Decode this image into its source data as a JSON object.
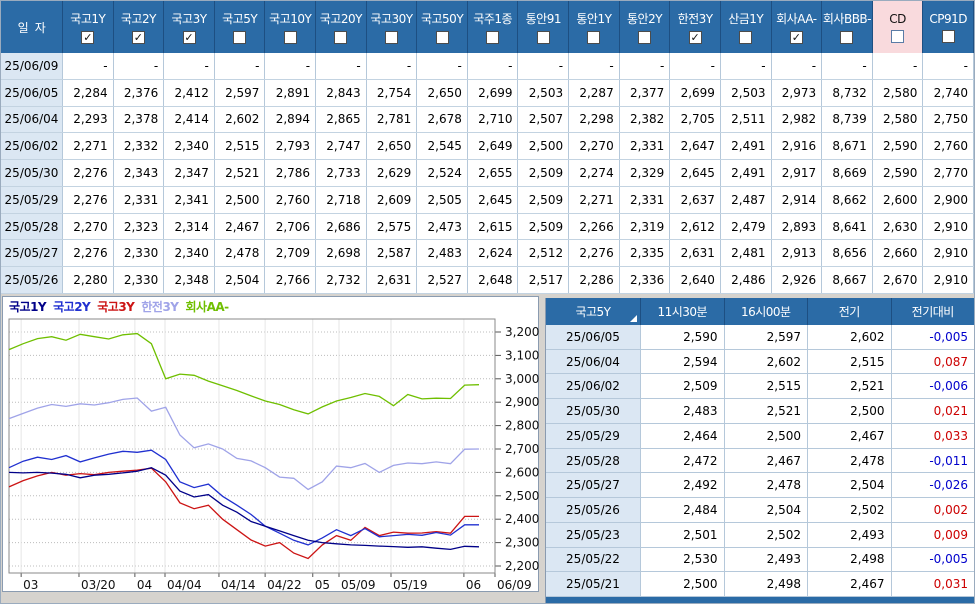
{
  "window": {
    "accent_blue": "#2b6ba6",
    "header_highlight_pink": "#f9dadd",
    "date_cell_blue": "#dbe7f3"
  },
  "colors": {
    "negative": "#0000cc",
    "positive": "#cc0000"
  },
  "top_table": {
    "date_header": "일  자",
    "columns": [
      {
        "label": "국고1Y",
        "checked": true,
        "highlight": false
      },
      {
        "label": "국고2Y",
        "checked": true,
        "highlight": false
      },
      {
        "label": "국고3Y",
        "checked": true,
        "highlight": false
      },
      {
        "label": "국고5Y",
        "checked": false,
        "highlight": false
      },
      {
        "label": "국고10Y",
        "checked": false,
        "highlight": false
      },
      {
        "label": "국고20Y",
        "checked": false,
        "highlight": false
      },
      {
        "label": "국고30Y",
        "checked": false,
        "highlight": false
      },
      {
        "label": "국고50Y",
        "checked": false,
        "highlight": false
      },
      {
        "label": "국주1종",
        "checked": false,
        "highlight": false
      },
      {
        "label": "통안91",
        "checked": false,
        "highlight": false
      },
      {
        "label": "통안1Y",
        "checked": false,
        "highlight": false
      },
      {
        "label": "통안2Y",
        "checked": false,
        "highlight": false
      },
      {
        "label": "한전3Y",
        "checked": true,
        "highlight": false
      },
      {
        "label": "산금1Y",
        "checked": false,
        "highlight": false
      },
      {
        "label": "회사AA-",
        "checked": true,
        "highlight": false
      },
      {
        "label": "회사BBB-",
        "checked": false,
        "highlight": false
      },
      {
        "label": "CD",
        "checked": false,
        "highlight": true
      },
      {
        "label": "CP91D",
        "checked": false,
        "highlight": false
      }
    ],
    "rows": [
      {
        "date": "25/06/09",
        "values": [
          "-",
          "-",
          "-",
          "-",
          "-",
          "-",
          "-",
          "-",
          "-",
          "-",
          "-",
          "-",
          "-",
          "-",
          "-",
          "-",
          "-",
          "-"
        ]
      },
      {
        "date": "25/06/05",
        "values": [
          "2,284",
          "2,376",
          "2,412",
          "2,597",
          "2,891",
          "2,843",
          "2,754",
          "2,650",
          "2,699",
          "2,503",
          "2,287",
          "2,377",
          "2,699",
          "2,503",
          "2,973",
          "8,732",
          "2,580",
          "2,740"
        ]
      },
      {
        "date": "25/06/04",
        "values": [
          "2,293",
          "2,378",
          "2,414",
          "2,602",
          "2,894",
          "2,865",
          "2,781",
          "2,678",
          "2,710",
          "2,507",
          "2,298",
          "2,382",
          "2,705",
          "2,511",
          "2,982",
          "8,739",
          "2,580",
          "2,750"
        ]
      },
      {
        "date": "25/06/02",
        "values": [
          "2,271",
          "2,332",
          "2,340",
          "2,515",
          "2,793",
          "2,747",
          "2,650",
          "2,545",
          "2,649",
          "2,500",
          "2,270",
          "2,331",
          "2,647",
          "2,491",
          "2,916",
          "8,671",
          "2,590",
          "2,760"
        ]
      },
      {
        "date": "25/05/30",
        "values": [
          "2,276",
          "2,343",
          "2,347",
          "2,521",
          "2,786",
          "2,733",
          "2,629",
          "2,524",
          "2,655",
          "2,509",
          "2,274",
          "2,329",
          "2,645",
          "2,491",
          "2,917",
          "8,669",
          "2,590",
          "2,770"
        ]
      },
      {
        "date": "25/05/29",
        "values": [
          "2,276",
          "2,331",
          "2,341",
          "2,500",
          "2,760",
          "2,718",
          "2,609",
          "2,505",
          "2,645",
          "2,509",
          "2,271",
          "2,331",
          "2,637",
          "2,487",
          "2,914",
          "8,662",
          "2,600",
          "2,900"
        ]
      },
      {
        "date": "25/05/28",
        "values": [
          "2,270",
          "2,323",
          "2,314",
          "2,467",
          "2,706",
          "2,686",
          "2,575",
          "2,473",
          "2,615",
          "2,509",
          "2,266",
          "2,319",
          "2,612",
          "2,479",
          "2,893",
          "8,641",
          "2,630",
          "2,910"
        ]
      },
      {
        "date": "25/05/27",
        "values": [
          "2,276",
          "2,330",
          "2,340",
          "2,478",
          "2,709",
          "2,698",
          "2,587",
          "2,483",
          "2,624",
          "2,512",
          "2,276",
          "2,335",
          "2,631",
          "2,481",
          "2,913",
          "8,656",
          "2,660",
          "2,910"
        ]
      },
      {
        "date": "25/05/26",
        "values": [
          "2,280",
          "2,330",
          "2,348",
          "2,504",
          "2,766",
          "2,732",
          "2,631",
          "2,527",
          "2,648",
          "2,517",
          "2,286",
          "2,336",
          "2,640",
          "2,486",
          "2,926",
          "8,667",
          "2,670",
          "2,910"
        ]
      }
    ]
  },
  "chart": {
    "type": "line",
    "x_end": 0.967,
    "ylim": [
      2.17,
      3.256
    ],
    "y_ticks": [
      {
        "label": "3,200",
        "value": 3.2
      },
      {
        "label": "3,100",
        "value": 3.1
      },
      {
        "label": "3,000",
        "value": 3.0
      },
      {
        "label": "2,900",
        "value": 2.9
      },
      {
        "label": "2,800",
        "value": 2.8
      },
      {
        "label": "2,700",
        "value": 2.7
      },
      {
        "label": "2,600",
        "value": 2.6
      },
      {
        "label": "2,500",
        "value": 2.5
      },
      {
        "label": "2,400",
        "value": 2.4
      },
      {
        "label": "2,300",
        "value": 2.3
      },
      {
        "label": "2,200",
        "value": 2.2
      }
    ],
    "x_ticks": [
      {
        "label": "03",
        "f": 0.025
      },
      {
        "label": "03/20",
        "f": 0.144
      },
      {
        "label": "04",
        "f": 0.259
      },
      {
        "label": "04/04",
        "f": 0.321
      },
      {
        "label": "04/14",
        "f": 0.432
      },
      {
        "label": "04/22",
        "f": 0.527
      },
      {
        "label": "05",
        "f": 0.625
      },
      {
        "label": "05/09",
        "f": 0.679
      },
      {
        "label": "05/19",
        "f": 0.786
      },
      {
        "label": "06",
        "f": 0.936
      },
      {
        "label": "06/09",
        "f": 1.0
      }
    ],
    "series": [
      {
        "name": "ktb1y",
        "label": "국고1Y",
        "color": "#000088",
        "values": [
          2.6,
          2.598,
          2.6,
          2.597,
          2.592,
          2.577,
          2.588,
          2.592,
          2.598,
          2.605,
          2.62,
          2.588,
          2.52,
          2.495,
          2.505,
          2.46,
          2.43,
          2.39,
          2.37,
          2.35,
          2.33,
          2.31,
          2.3,
          2.295,
          2.29,
          2.288,
          2.285,
          2.283,
          2.28,
          2.282,
          2.276,
          2.271,
          2.284,
          2.282
        ]
      },
      {
        "name": "ktb2y",
        "label": "국고2Y",
        "color": "#2030d0",
        "values": [
          2.62,
          2.648,
          2.665,
          2.655,
          2.672,
          2.645,
          2.662,
          2.678,
          2.69,
          2.686,
          2.695,
          2.655,
          2.56,
          2.535,
          2.55,
          2.498,
          2.46,
          2.42,
          2.37,
          2.34,
          2.31,
          2.29,
          2.32,
          2.355,
          2.33,
          2.36,
          2.325,
          2.33,
          2.335,
          2.331,
          2.343,
          2.332,
          2.376,
          2.376
        ]
      },
      {
        "name": "ktb3y",
        "label": "국고3Y",
        "color": "#cc1414",
        "values": [
          2.538,
          2.565,
          2.585,
          2.6,
          2.588,
          2.595,
          2.59,
          2.6,
          2.605,
          2.61,
          2.618,
          2.56,
          2.47,
          2.445,
          2.46,
          2.4,
          2.355,
          2.311,
          2.285,
          2.3,
          2.255,
          2.232,
          2.29,
          2.33,
          2.31,
          2.365,
          2.33,
          2.345,
          2.34,
          2.341,
          2.347,
          2.34,
          2.412,
          2.412
        ]
      },
      {
        "name": "hanjeon3y",
        "label": "한전3Y",
        "color": "#9fa3e8",
        "values": [
          2.83,
          2.852,
          2.875,
          2.89,
          2.882,
          2.893,
          2.888,
          2.898,
          2.912,
          2.918,
          2.862,
          2.878,
          2.76,
          2.705,
          2.722,
          2.7,
          2.66,
          2.649,
          2.62,
          2.58,
          2.575,
          2.527,
          2.56,
          2.627,
          2.62,
          2.638,
          2.6,
          2.63,
          2.64,
          2.637,
          2.645,
          2.637,
          2.699,
          2.7
        ]
      },
      {
        "name": "corpAAminus",
        "label": "회사AA-",
        "color": "#6fbf00",
        "values": [
          3.125,
          3.15,
          3.172,
          3.18,
          3.165,
          3.19,
          3.18,
          3.17,
          3.188,
          3.193,
          3.15,
          3.0,
          3.02,
          3.015,
          2.99,
          2.97,
          2.95,
          2.927,
          2.905,
          2.89,
          2.868,
          2.85,
          2.88,
          2.905,
          2.92,
          2.937,
          2.925,
          2.885,
          2.933,
          2.914,
          2.917,
          2.916,
          2.973,
          2.975
        ]
      }
    ]
  },
  "right_table": {
    "headers": [
      "국고5Y",
      "11시30분",
      "16시00분",
      "전기",
      "전기대비"
    ],
    "rows": [
      {
        "date": "25/06/05",
        "values": [
          "2,590",
          "2,597",
          "2,602",
          "-0,005"
        ]
      },
      {
        "date": "25/06/04",
        "values": [
          "2,594",
          "2,602",
          "2,515",
          "0,087"
        ]
      },
      {
        "date": "25/06/02",
        "values": [
          "2,509",
          "2,515",
          "2,521",
          "-0,006"
        ]
      },
      {
        "date": "25/05/30",
        "values": [
          "2,483",
          "2,521",
          "2,500",
          "0,021"
        ]
      },
      {
        "date": "25/05/29",
        "values": [
          "2,464",
          "2,500",
          "2,467",
          "0,033"
        ]
      },
      {
        "date": "25/05/28",
        "values": [
          "2,472",
          "2,467",
          "2,478",
          "-0,011"
        ]
      },
      {
        "date": "25/05/27",
        "values": [
          "2,492",
          "2,478",
          "2,504",
          "-0,026"
        ]
      },
      {
        "date": "25/05/26",
        "values": [
          "2,484",
          "2,504",
          "2,502",
          "0,002"
        ]
      },
      {
        "date": "25/05/23",
        "values": [
          "2,501",
          "2,502",
          "2,493",
          "0,009"
        ]
      },
      {
        "date": "25/05/22",
        "values": [
          "2,530",
          "2,493",
          "2,498",
          "-0,005"
        ]
      },
      {
        "date": "25/05/21",
        "values": [
          "2,500",
          "2,498",
          "2,467",
          "0,031"
        ]
      }
    ]
  }
}
